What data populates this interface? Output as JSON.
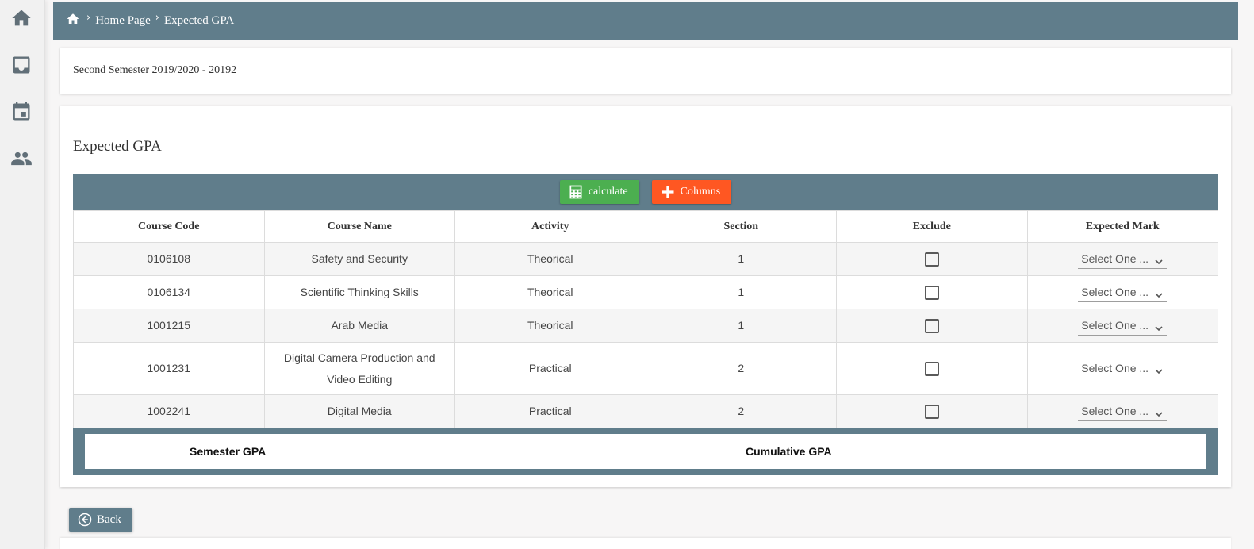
{
  "rail": {
    "icons": [
      "home-icon",
      "inbox-icon",
      "calendar-icon",
      "people-icon"
    ]
  },
  "breadcrumb": {
    "items": [
      "Home Page",
      "Expected GPA"
    ]
  },
  "semester": {
    "label": "Second Semester 2019/2020 - 20192"
  },
  "section": {
    "title": "Expected GPA"
  },
  "toolbar": {
    "calculate_label": "calculate",
    "columns_label": "Columns"
  },
  "table": {
    "headers": [
      "Course Code",
      "Course Name",
      "Activity",
      "Section",
      "Exclude",
      "Expected Mark"
    ],
    "rows": [
      {
        "code": "0106108",
        "name": "Safety and Security",
        "activity": "Theorical",
        "section": "1",
        "exclude": false,
        "mark": "Select One ..."
      },
      {
        "code": "0106134",
        "name": "Scientific Thinking Skills",
        "activity": "Theorical",
        "section": "1",
        "exclude": false,
        "mark": "Select One ..."
      },
      {
        "code": "1001215",
        "name": "Arab Media",
        "activity": "Theorical",
        "section": "1",
        "exclude": false,
        "mark": "Select One ..."
      },
      {
        "code": "1001231",
        "name": "Digital Camera Production and Video Editing",
        "activity": "Practical",
        "section": "2",
        "exclude": false,
        "mark": "Select One ..."
      },
      {
        "code": "1002241",
        "name": "Digital Media",
        "activity": "Practical",
        "section": "2",
        "exclude": false,
        "mark": "Select One ..."
      }
    ]
  },
  "gpa": {
    "semester_label": "Semester GPA",
    "cumulative_label": "Cumulative GPA"
  },
  "back": {
    "label": "Back"
  },
  "colors": {
    "primary": "#607d8b",
    "green": "#4caf50",
    "orange": "#ff5722"
  }
}
